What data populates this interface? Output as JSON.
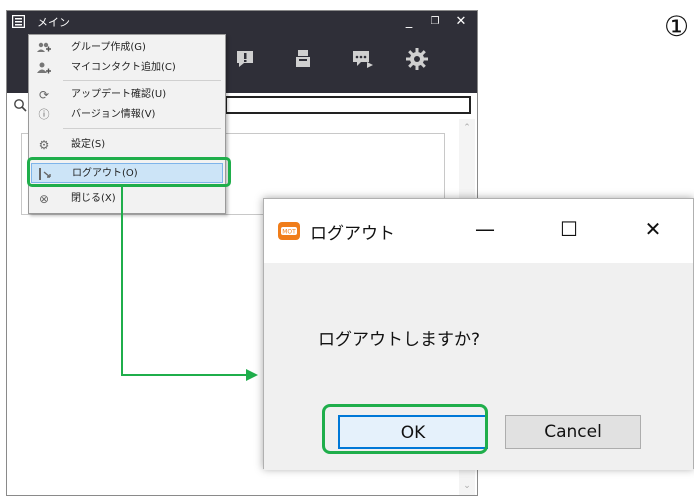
{
  "window": {
    "title": "メイン",
    "minimize": "_",
    "restore": "❐",
    "close": "✕"
  },
  "menu": {
    "items": [
      {
        "label": "グループ作成(G)",
        "icon": "add-group-icon"
      },
      {
        "label": "マイコンタクト追加(C)",
        "icon": "add-contact-icon"
      },
      {
        "label": "アップデート確認(U)",
        "icon": "refresh-icon"
      },
      {
        "label": "バージョン情報(V)",
        "icon": "info-icon"
      },
      {
        "label": "設定(S)",
        "icon": "gear-icon"
      },
      {
        "label": "ログアウト(O)",
        "icon": "logout-icon"
      },
      {
        "label": "閉じる(X)",
        "icon": "close-circle-icon"
      }
    ]
  },
  "annotation": {
    "step_number": "①"
  },
  "dialog": {
    "title": "ログアウト",
    "minimize": "—",
    "maximize": "☐",
    "close": "✕",
    "message": "ログアウトしますか?",
    "ok_label": "OK",
    "cancel_label": "Cancel"
  },
  "colors": {
    "titlebar": "#2f2f38",
    "highlight_green": "#1fae4b",
    "menu_selected": "#cce4f7",
    "dialog_accent": "#0078d7"
  }
}
